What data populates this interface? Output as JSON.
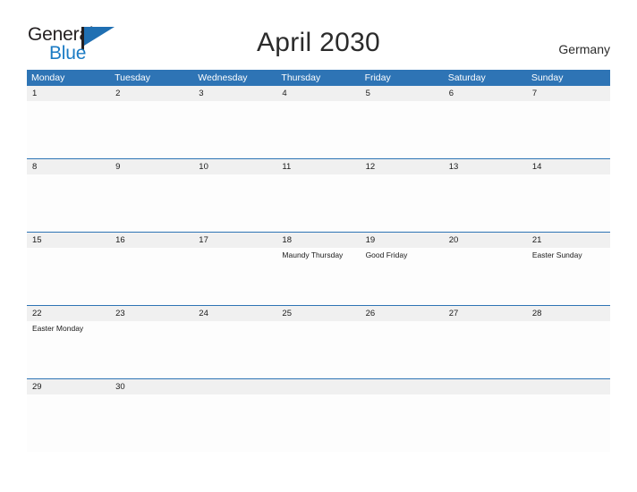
{
  "brand": {
    "word_one": "General",
    "word_two": "Blue",
    "flag_icon": "flag-triangle-icon",
    "colors": {
      "dark": "#231f20",
      "blue": "#1b7bc4"
    }
  },
  "header": {
    "title": "April 2030",
    "region": "Germany"
  },
  "calendar": {
    "accent_color": "#2e74b5",
    "band_color": "#f0f0f0",
    "weekdays": [
      "Monday",
      "Tuesday",
      "Wednesday",
      "Thursday",
      "Friday",
      "Saturday",
      "Sunday"
    ],
    "weeks": [
      {
        "days": [
          {
            "number": "1",
            "event": ""
          },
          {
            "number": "2",
            "event": ""
          },
          {
            "number": "3",
            "event": ""
          },
          {
            "number": "4",
            "event": ""
          },
          {
            "number": "5",
            "event": ""
          },
          {
            "number": "6",
            "event": ""
          },
          {
            "number": "7",
            "event": ""
          }
        ]
      },
      {
        "days": [
          {
            "number": "8",
            "event": ""
          },
          {
            "number": "9",
            "event": ""
          },
          {
            "number": "10",
            "event": ""
          },
          {
            "number": "11",
            "event": ""
          },
          {
            "number": "12",
            "event": ""
          },
          {
            "number": "13",
            "event": ""
          },
          {
            "number": "14",
            "event": ""
          }
        ]
      },
      {
        "days": [
          {
            "number": "15",
            "event": ""
          },
          {
            "number": "16",
            "event": ""
          },
          {
            "number": "17",
            "event": ""
          },
          {
            "number": "18",
            "event": "Maundy Thursday"
          },
          {
            "number": "19",
            "event": "Good Friday"
          },
          {
            "number": "20",
            "event": ""
          },
          {
            "number": "21",
            "event": "Easter Sunday"
          }
        ]
      },
      {
        "days": [
          {
            "number": "22",
            "event": "Easter Monday"
          },
          {
            "number": "23",
            "event": ""
          },
          {
            "number": "24",
            "event": ""
          },
          {
            "number": "25",
            "event": ""
          },
          {
            "number": "26",
            "event": ""
          },
          {
            "number": "27",
            "event": ""
          },
          {
            "number": "28",
            "event": ""
          }
        ]
      },
      {
        "days": [
          {
            "number": "29",
            "event": ""
          },
          {
            "number": "30",
            "event": ""
          },
          {
            "number": "",
            "event": ""
          },
          {
            "number": "",
            "event": ""
          },
          {
            "number": "",
            "event": ""
          },
          {
            "number": "",
            "event": ""
          },
          {
            "number": "",
            "event": ""
          }
        ]
      }
    ]
  }
}
